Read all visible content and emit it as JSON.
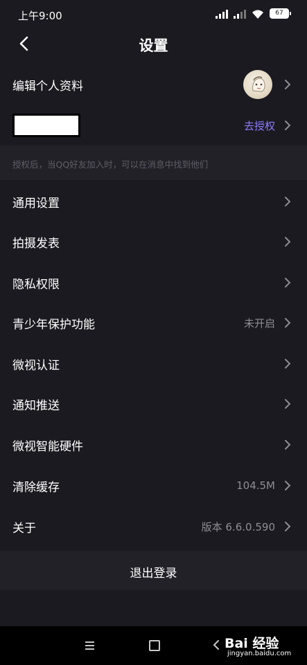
{
  "status_bar": {
    "time": "上午9:00",
    "battery": "67"
  },
  "header": {
    "title": "设置"
  },
  "profile": {
    "edit_label": "编辑个人资料",
    "authorize_label": "去授权",
    "hint": "授权后，当QQ好友加入时，可以在消息中找到他们"
  },
  "settings": {
    "items": [
      {
        "label": "通用设置",
        "value": ""
      },
      {
        "label": "拍摄发表",
        "value": ""
      },
      {
        "label": "隐私权限",
        "value": ""
      },
      {
        "label": "青少年保护功能",
        "value": "未开启"
      },
      {
        "label": "微视认证",
        "value": ""
      },
      {
        "label": "通知推送",
        "value": ""
      },
      {
        "label": "微视智能硬件",
        "value": ""
      },
      {
        "label": "清除缓存",
        "value": "104.5M"
      },
      {
        "label": "关于",
        "value": "版本 6.6.0.590"
      }
    ]
  },
  "logout": {
    "label": "退出登录"
  },
  "watermark": {
    "brand": "Bai 经验",
    "url": "jingyan.baidu.com"
  },
  "colors": {
    "background": "#1b1a20",
    "section": "#222128",
    "accent": "#8e7cff",
    "secondary_text": "#8e8d94"
  }
}
